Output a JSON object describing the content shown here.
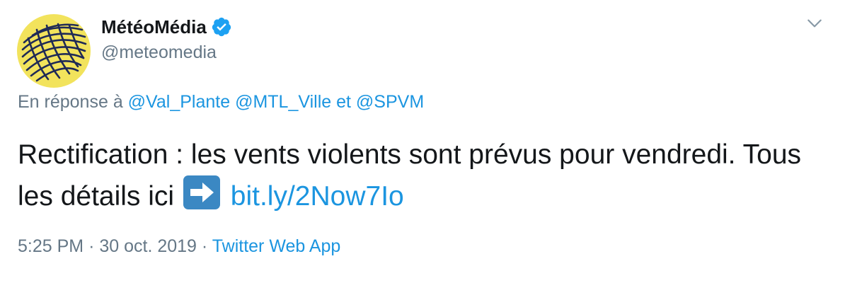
{
  "author": {
    "name": "MétéoMédia",
    "handle": "@meteomedia",
    "avatar_icon": "meteomedia-logo",
    "verified_icon": "verified-badge-icon"
  },
  "reply": {
    "prefix": "En réponse à",
    "mention_1": "@Val_Plante",
    "mention_2": "@MTL_Ville",
    "conjunction": "et",
    "mention_3": "@SPVM"
  },
  "tweet": {
    "text_part_1": "Rectification : les vents violents sont prévus pour vendredi. Tous les détails ici",
    "emoji": "right-arrow-emoji",
    "link": "bit.ly/2Now7Io"
  },
  "meta": {
    "time": "5:25 PM",
    "separator": "·",
    "date": "30 oct. 2019",
    "source": "Twitter Web App"
  },
  "colors": {
    "link": "#1b95e0",
    "secondary_text": "#657786",
    "avatar_bg": "#f2e35c",
    "logo_navy": "#1f2a56",
    "emoji_bg": "#3b88c3"
  }
}
